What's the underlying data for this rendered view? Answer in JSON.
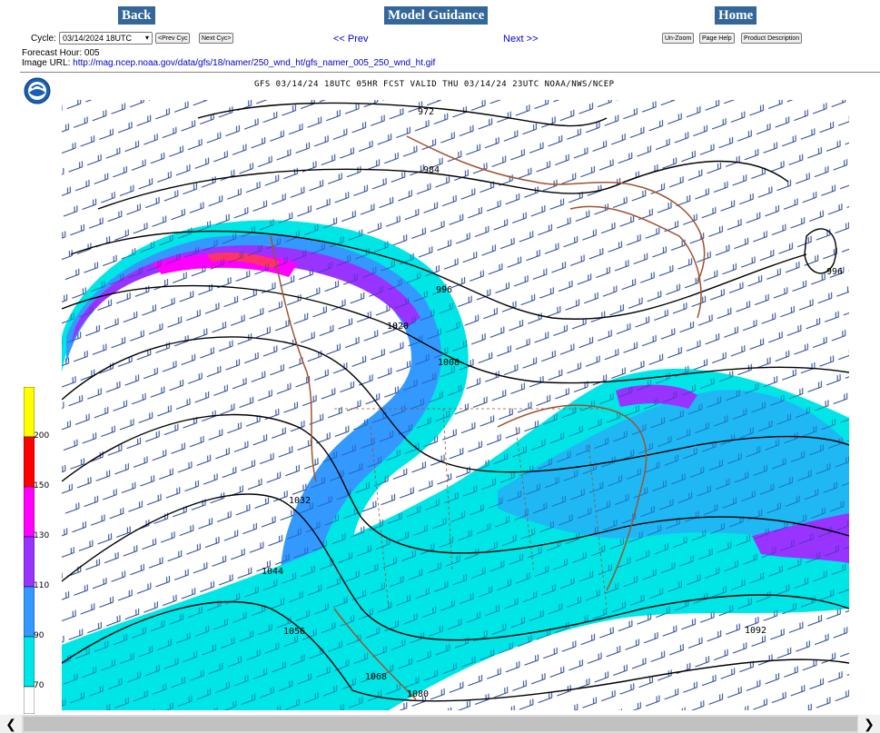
{
  "nav": {
    "back_label": "Back",
    "model_label": "Model Guidance",
    "home_label": "Home",
    "prev_label": "<< Prev",
    "next_label": "Next >>"
  },
  "cycle": {
    "label": "Cycle:",
    "selected": "03/14/2024 18UTC",
    "prev_cyc_label": "<Prev Cyc",
    "next_cyc_label": "Next Cyc>"
  },
  "tools": {
    "unzoom_label": "Un-Zoom",
    "page_help_label": "Page Help",
    "product_desc_label": "Product Description"
  },
  "forecast": {
    "label": "Forecast Hour: 005",
    "url_label": "Image URL:",
    "url": "http://mag.ncep.noaa.gov/data/gfs/18/namer/250_wnd_ht/gfs_namer_005_250_wnd_ht.gif"
  },
  "map": {
    "title": "GFS 03/14/24 18UTC 05HR FCST VALID THU 03/14/24 23UTC NOAA/NWS/NCEP",
    "contour_labels": [
      "972",
      "984",
      "996",
      "996",
      "1020",
      "1008",
      "1032",
      "1044",
      "1056",
      "1068",
      "1080",
      "1092"
    ],
    "colorbar_ticks": [
      "200",
      "150",
      "130",
      "110",
      "90",
      "70"
    ],
    "colors": {
      "c70": "#00e5e5",
      "c90": "#3399ff",
      "c110": "#9933ff",
      "c130": "#ff00ff",
      "c150": "#ff0000",
      "c200": "#ffff00",
      "barb": "#1a3a8a",
      "coast": "#a0522d"
    }
  },
  "scrollbar": {
    "left_arrow": "❮",
    "right_arrow": "❯"
  }
}
